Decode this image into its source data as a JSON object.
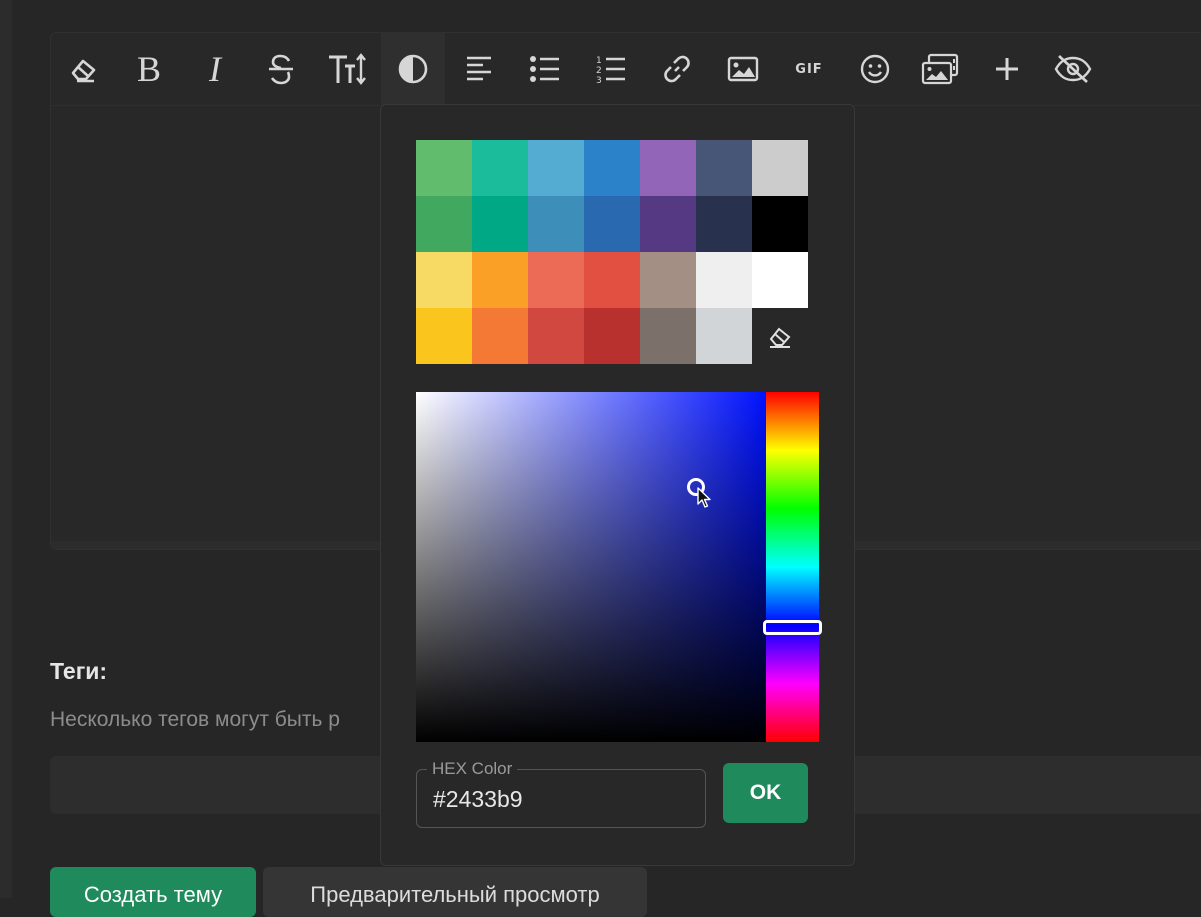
{
  "toolbar": {
    "tools": [
      {
        "name": "clear-formatting",
        "icon": "eraser-icon"
      },
      {
        "name": "bold",
        "icon": "bold-icon",
        "glyph": "B"
      },
      {
        "name": "italic",
        "icon": "italic-icon",
        "glyph": "I"
      },
      {
        "name": "strikethrough",
        "icon": "strikethrough-icon"
      },
      {
        "name": "font-size",
        "icon": "text-size-icon"
      },
      {
        "name": "color",
        "icon": "contrast-icon",
        "active": true
      },
      {
        "name": "align",
        "icon": "align-left-icon"
      },
      {
        "name": "bullet-list",
        "icon": "bullet-list-icon"
      },
      {
        "name": "numbered-list",
        "icon": "numbered-list-icon"
      },
      {
        "name": "link",
        "icon": "link-icon"
      },
      {
        "name": "image",
        "icon": "image-icon"
      },
      {
        "name": "gif",
        "icon": "gif-icon",
        "glyph": "GIF"
      },
      {
        "name": "emoji",
        "icon": "smiley-icon"
      },
      {
        "name": "gallery",
        "icon": "gallery-icon"
      },
      {
        "name": "more",
        "icon": "plus-icon"
      },
      {
        "name": "spoiler",
        "icon": "eye-slash-icon"
      }
    ]
  },
  "tags": {
    "label": "Теги:",
    "hint": "Несколько тегов могут быть р"
  },
  "buttons": {
    "create": "Создать тему",
    "preview": "Предварительный просмотр"
  },
  "color_picker": {
    "palette": [
      [
        "#61bd6d",
        "#1abc9c",
        "#54acd2",
        "#2c82c9",
        "#9365b8",
        "#475577",
        "#cccccc"
      ],
      [
        "#41a85f",
        "#00a885",
        "#3d8eb9",
        "#2969b0",
        "#553982",
        "#28324e",
        "#000000"
      ],
      [
        "#f7da64",
        "#fba026",
        "#eb6b56",
        "#e25041",
        "#a38f84",
        "#efefef",
        "#ffffff"
      ],
      [
        "#fac51c",
        "#f37934",
        "#d14841",
        "#b8312f",
        "#7c706b",
        "#d1d5d8"
      ]
    ],
    "remove_color_icon": "eraser-icon",
    "hue_fraction": 0.67,
    "hue_color": "#0012ff",
    "saturation": 0.8,
    "value": 0.73,
    "hex_label": "HEX Color",
    "hex_value": "#2433b9",
    "ok_label": "OK"
  }
}
